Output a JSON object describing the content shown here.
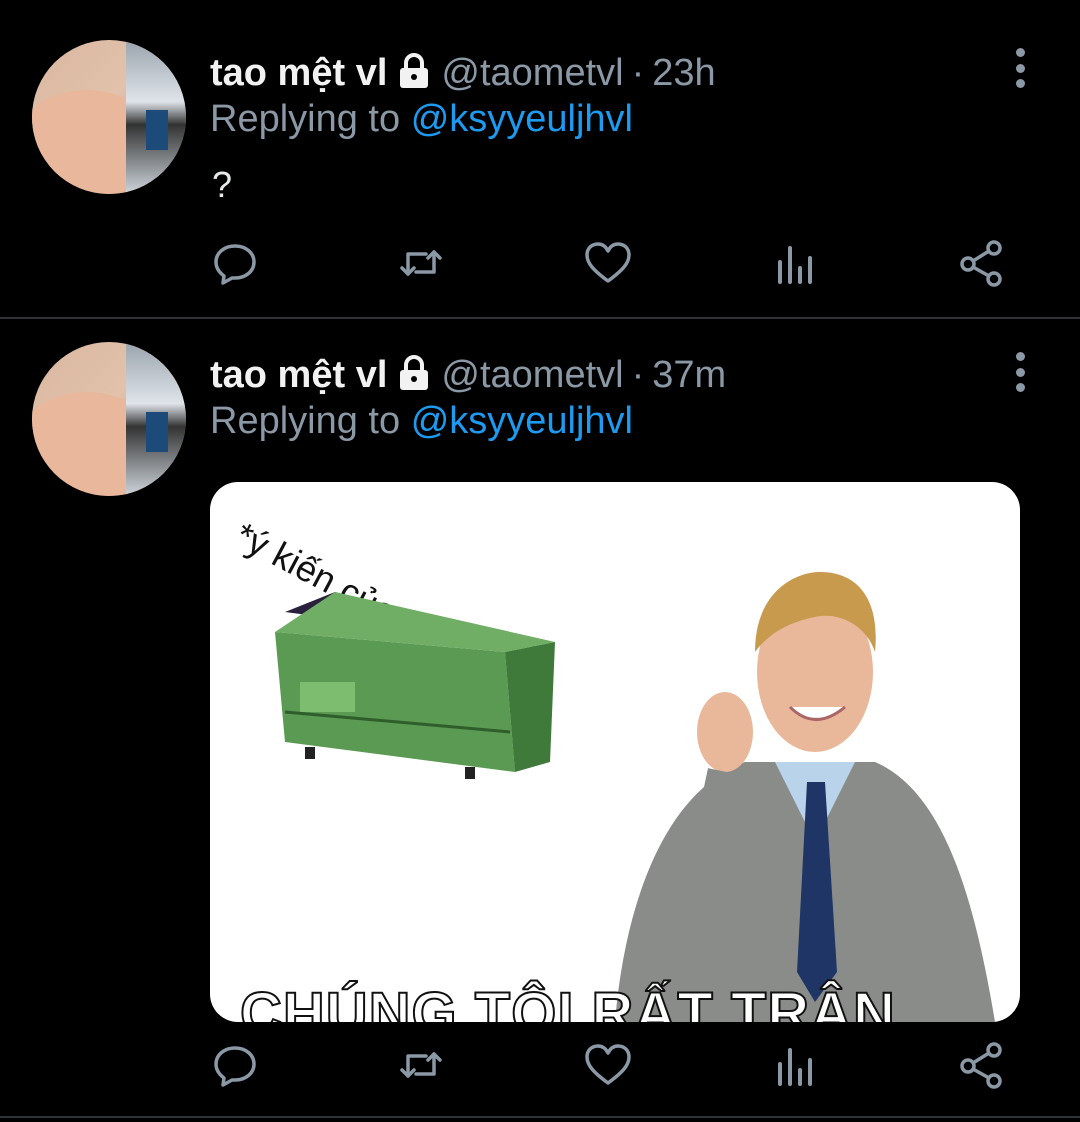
{
  "tweets": [
    {
      "author_name": "tao mệt vl",
      "handle": "@taometvl",
      "separator": "·",
      "time": "23h",
      "replying_prefix": "Replying to",
      "replying_to": "@ksyyeuljhvl",
      "text": "?"
    },
    {
      "author_name": "tao mệt vl",
      "handle": "@taometvl",
      "separator": "·",
      "time": "37m",
      "replying_prefix": "Replying to",
      "replying_to": "@ksyyeuljhvl",
      "media": {
        "overlay_text": "*ý kiến của",
        "caption": "CHÚNG TÔI RẤT TRÂN"
      }
    }
  ],
  "icons": {
    "lock": "lock-icon",
    "more": "more-vertical-icon",
    "reply": "reply-icon",
    "retweet": "retweet-icon",
    "like": "heart-icon",
    "stats": "analytics-icon",
    "share": "share-icon"
  },
  "colors": {
    "background": "#000000",
    "text": "#e7e9ea",
    "muted": "#8b98a5",
    "accent": "#1d9bf0",
    "divider": "#2f3336"
  }
}
